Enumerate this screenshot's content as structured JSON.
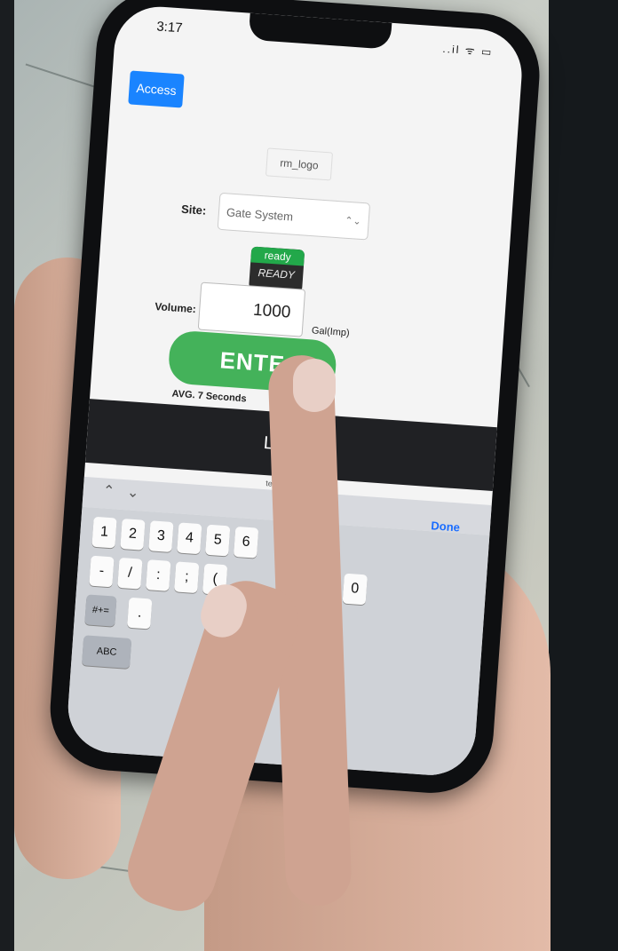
{
  "status_bar": {
    "time": "3:17",
    "icons": "..il ᯤ ▭"
  },
  "header": {
    "access_button": "Access"
  },
  "logo": {
    "alt": "rm_logo"
  },
  "site": {
    "label": "Site:",
    "selected": "Gate System",
    "chevron": "⌃⌄"
  },
  "status_badge": {
    "top": "ready",
    "bottom": "READY"
  },
  "volume": {
    "label": "Volume:",
    "value": "1000",
    "unit": "Gal(Imp)"
  },
  "enter_button": {
    "label": "ENTE"
  },
  "avg_text": "AVG. 7 Seconds",
  "logout_button": {
    "label": "LOG C"
  },
  "url": "text2car.com",
  "keyboard": {
    "toolbar": {
      "up": "⌃",
      "down": "⌄",
      "done": "Done"
    },
    "row1": [
      "1",
      "2",
      "3",
      "4",
      "5",
      "6"
    ],
    "row2": [
      "-",
      "/",
      ":",
      ";",
      "("
    ],
    "row2_end": "0",
    "row3_left": "#+=",
    "row3": [
      "."
    ],
    "row4_left": "ABC"
  },
  "colors": {
    "access": "#1a84ff",
    "enter": "#44b25a",
    "ready": "#22a84a",
    "done": "#1a6dff"
  }
}
